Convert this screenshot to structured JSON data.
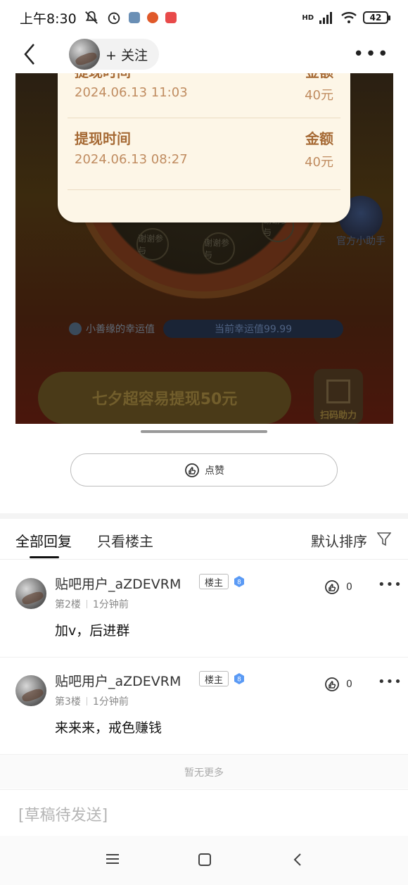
{
  "status_bar": {
    "time": "上午8:30",
    "network": "HD",
    "battery": "42",
    "icons": [
      "mute-icon",
      "alarm-icon",
      "app-icon",
      "app-icon",
      "app-icon",
      "signal-icon",
      "wifi-icon",
      "battery-icon"
    ]
  },
  "nav": {
    "follow_label": "+ 关注",
    "more_label": "•••"
  },
  "post_image": {
    "withdraw_records": [
      {
        "label": "提现时间",
        "time": "2024.06.13 11:03",
        "amount_label": "金额",
        "amount": "40元"
      },
      {
        "label": "提现时间",
        "time": "2024.06.13 08:27",
        "amount_label": "金额",
        "amount": "40元"
      }
    ],
    "wheel_tags": [
      "谢谢参与",
      "谢谢参与",
      "谢谢参与"
    ],
    "helper_label": "官方小助手",
    "luck_label": "小善缘的幸运值",
    "luck_value": "当前幸运值99.99",
    "banner_text": "七夕超容易提现50元",
    "qr_label": "扫码助力"
  },
  "like_button": {
    "label": "点赞"
  },
  "tabs": {
    "all": "全部回复",
    "owner_only": "只看楼主",
    "sort": "默认排序"
  },
  "replies": [
    {
      "username": "贴吧用户_aZDEVRM",
      "owner_badge": "楼主",
      "level": "8",
      "floor": "第2楼",
      "time": "1分钟前",
      "content": "加v，后进群",
      "likes": "0"
    },
    {
      "username": "贴吧用户_aZDEVRM",
      "owner_badge": "楼主",
      "level": "8",
      "floor": "第3楼",
      "time": "1分钟前",
      "content": "来来来，戒色赚钱",
      "likes": "0"
    }
  ],
  "no_more": "暂无更多",
  "draft": {
    "placeholder": "[草稿待发送]"
  },
  "colors": {
    "accent_text": "#a66a35",
    "level_badge": "#5a9af5",
    "background": "#ffffff"
  }
}
